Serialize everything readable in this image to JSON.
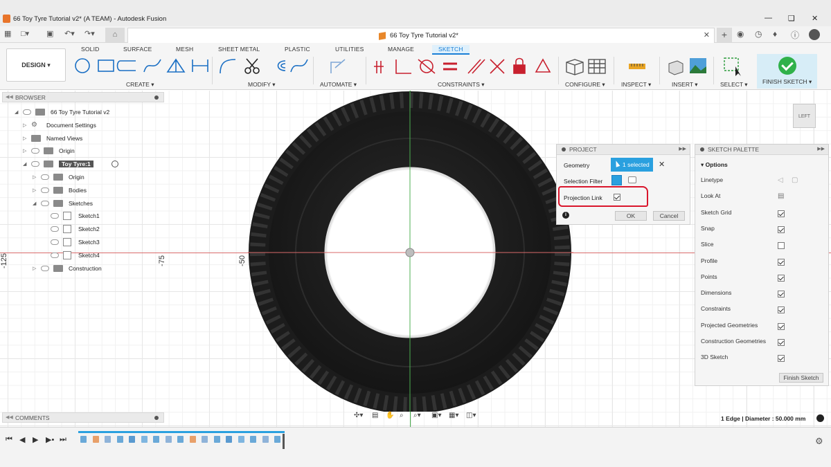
{
  "window": {
    "title": "66 Toy Tyre Tutorial v2* (A TEAM) - Autodesk Fusion",
    "document_tab": "66 Toy Tyre Tutorial v2*"
  },
  "workspace": {
    "label": "DESIGN ▾"
  },
  "tabs": [
    {
      "label": "SOLID",
      "active": false
    },
    {
      "label": "SURFACE",
      "active": false
    },
    {
      "label": "MESH",
      "active": false
    },
    {
      "label": "SHEET METAL",
      "active": false
    },
    {
      "label": "PLASTIC",
      "active": false
    },
    {
      "label": "UTILITIES",
      "active": false
    },
    {
      "label": "MANAGE",
      "active": false
    },
    {
      "label": "SKETCH",
      "active": true
    }
  ],
  "groups": [
    "CREATE ▾",
    "MODIFY ▾",
    "AUTOMATE ▾",
    "CONSTRAINTS ▾",
    "CONFIGURE ▾",
    "INSPECT ▾",
    "INSERT ▾",
    "SELECT ▾"
  ],
  "finish_sketch": "FINISH SKETCH ▾",
  "browser": {
    "title": "BROWSER",
    "items": [
      {
        "label": "66 Toy Tyre Tutorial v2",
        "icon": "document-icon"
      },
      {
        "label": "Document Settings",
        "icon": "gear-icon"
      },
      {
        "label": "Named Views",
        "icon": "folder-icon"
      },
      {
        "label": "Origin",
        "icon": "folder-icon"
      },
      {
        "label": "Toy Tyre:1",
        "icon": "component-icon"
      },
      {
        "label": "Origin",
        "icon": "folder-icon"
      },
      {
        "label": "Bodies",
        "icon": "folder-icon"
      },
      {
        "label": "Sketches",
        "icon": "folder-icon"
      },
      {
        "label": "Sketch1",
        "icon": "sketch-icon"
      },
      {
        "label": "Sketch2",
        "icon": "sketch-icon"
      },
      {
        "label": "Sketch3",
        "icon": "sketch-icon"
      },
      {
        "label": "Sketch4",
        "icon": "sketch-icon"
      },
      {
        "label": "Construction",
        "icon": "folder-icon"
      }
    ]
  },
  "comments": {
    "title": "COMMENTS"
  },
  "axis_labels": [
    "-125",
    "-75",
    "-50"
  ],
  "viewcube": "LEFT",
  "project_dialog": {
    "title": "PROJECT",
    "geometry_label": "Geometry",
    "geometry_value": "1 selected",
    "filter_label": "Selection Filter",
    "link_label": "Projection Link",
    "link_checked": true,
    "ok": "OK",
    "cancel": "Cancel"
  },
  "sketch_palette": {
    "title": "SKETCH PALETTE",
    "section": "Options",
    "rows": [
      {
        "label": "Linetype",
        "type": "icons"
      },
      {
        "label": "Look At",
        "type": "icon"
      },
      {
        "label": "Sketch Grid",
        "checked": true
      },
      {
        "label": "Snap",
        "checked": true
      },
      {
        "label": "Slice",
        "checked": false
      },
      {
        "label": "Profile",
        "checked": true
      },
      {
        "label": "Points",
        "checked": true
      },
      {
        "label": "Dimensions",
        "checked": true
      },
      {
        "label": "Constraints",
        "checked": true
      },
      {
        "label": "Projected Geometries",
        "checked": true
      },
      {
        "label": "Construction Geometries",
        "checked": true
      },
      {
        "label": "3D Sketch",
        "checked": true
      }
    ],
    "finish": "Finish Sketch"
  },
  "status": "1 Edge | Diameter : 50.000 mm",
  "colors": {
    "accent": "#2aa0df",
    "finish_green": "#2fb14a",
    "annotation": "#d9152b"
  }
}
